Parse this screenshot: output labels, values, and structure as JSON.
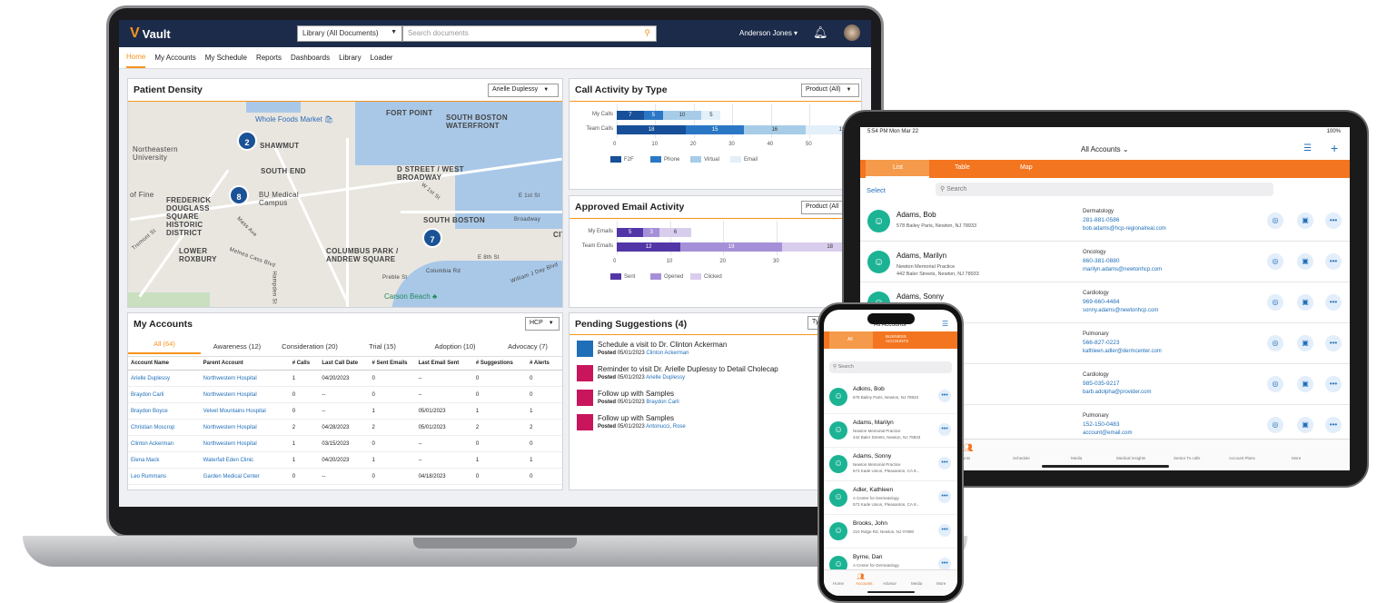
{
  "laptop": {
    "app_name": "Vault",
    "library_select": "Library (All Documents)",
    "search_placeholder": "Search documents",
    "user_name": "Anderson Jones",
    "nav": [
      "Home",
      "My Accounts",
      "My Schedule",
      "Reports",
      "Dashboards",
      "Library",
      "Loader"
    ],
    "patient_density": {
      "title": "Patient Density",
      "filter": "Arielle Duplessy",
      "map_labels": [
        "FORT POINT",
        "SOUTH BOSTON WATERFRONT",
        "SHAWMUT",
        "Northeastern University",
        "SOUTH END",
        "D STREET / WEST BROADWAY",
        "FREDERICK DOUGLASS SQUARE HISTORIC DISTRICT",
        "BU Medical Campus",
        "SOUTH BOSTON",
        "LOWER ROXBURY",
        "COLUMBUS PARK / ANDREW SQUARE",
        "CIT",
        "of Fine"
      ],
      "pois": [
        "Whole Foods Market",
        "Carson Beach"
      ],
      "clusters": [
        "2",
        "8",
        "7"
      ],
      "street_labels": [
        "E 1st St",
        "Broadway",
        "W 1st St",
        "E 8th St",
        "Preble St",
        "Columbia Rd",
        "William J Day Blvd",
        "Tremont St",
        "Mass Ave",
        "Melnea Cass Blvd",
        "Hampden St"
      ]
    },
    "call_activity": {
      "title": "Call Activity by Type",
      "filter": "Product (All)",
      "rows": [
        {
          "label": "My Calls",
          "values": [
            "7",
            "5",
            "10",
            "5"
          ]
        },
        {
          "label": "Team Calls",
          "values": [
            "18",
            "15",
            "16",
            "19"
          ]
        }
      ],
      "axis": [
        "0",
        "10",
        "20",
        "30",
        "40",
        "50"
      ],
      "legend": [
        "F2F",
        "Phone",
        "Virtual",
        "Email"
      ],
      "colors": [
        "#174f99",
        "#2a78c5",
        "#a7cce8",
        "#e3eff9"
      ]
    },
    "email_activity": {
      "title": "Approved Email Activity",
      "filter": "Product (All",
      "rows": [
        {
          "label": "My Emails",
          "values": [
            "5",
            "3",
            "6"
          ]
        },
        {
          "label": "Team Emails",
          "values": [
            "12",
            "19",
            "18"
          ]
        }
      ],
      "axis": [
        "0",
        "10",
        "20",
        "30"
      ],
      "legend": [
        "Sent",
        "Opened",
        "Clicked"
      ],
      "colors": [
        "#5236a8",
        "#a590d8",
        "#d9cdee"
      ]
    },
    "my_accounts": {
      "title": "My Accounts",
      "filter": "HCP",
      "tabs": [
        "All (64)",
        "Awareness (12)",
        "Consideration (20)",
        "Trial (15)",
        "Adoption (10)",
        "Advocacy (7)"
      ],
      "columns": [
        "Account Name",
        "Parent Account",
        "# Calls",
        "Last Call Date",
        "# Sent Emails",
        "Last Email Sent",
        "# Suggestions",
        "# Alerts"
      ],
      "rows": [
        [
          "Arielle Duplessy",
          "Northwestern Hospital",
          "1",
          "04/20/2023",
          "0",
          "--",
          "0",
          "0"
        ],
        [
          "Braydon Carli",
          "Northwestern Hospital",
          "0",
          "--",
          "0",
          "--",
          "0",
          "0"
        ],
        [
          "Braydon Boyce",
          "Velvet Mountains Hospital",
          "0",
          "--",
          "1",
          "05/01/2023",
          "1",
          "1"
        ],
        [
          "Christian Moscrop",
          "Northwestern Hospital",
          "2",
          "04/28/2023",
          "2",
          "05/01/2023",
          "2",
          "2"
        ],
        [
          "Clinton Ackerman",
          "Northwestern Hospital",
          "1",
          "03/15/2023",
          "0",
          "--",
          "0",
          "0"
        ],
        [
          "Elena Mack",
          "Waterfall Eden Clinic",
          "1",
          "04/20/2023",
          "1",
          "--",
          "1",
          "1"
        ],
        [
          "Leo Rummans",
          "Garden Medical Center",
          "0",
          "--",
          "0",
          "04/18/2023",
          "0",
          "0"
        ]
      ]
    },
    "suggestions": {
      "title": "Pending Suggestions (4)",
      "filter": "Ty",
      "items": [
        {
          "title": "Schedule a visit to Dr. Clinton Ackerman",
          "posted_label": "Posted",
          "date": "05/01/2023",
          "who": "Clinton Ackerman",
          "color": "#1f6fb8"
        },
        {
          "title": "Reminder to visit Dr. Arielle Duplessy to Detail Cholecap",
          "posted_label": "Posted",
          "date": "05/01/2023",
          "who": "Arielle Duplessy",
          "color": "#c8155c"
        },
        {
          "title": "Follow up with Samples",
          "posted_label": "Posted",
          "date": "05/01/2023",
          "who": "Braydon Carli",
          "color": "#c8155c"
        },
        {
          "title": "Follow up with Samples",
          "posted_label": "Posted",
          "date": "05/01/2023",
          "who": "Antonucci, Rose",
          "color": "#c8155c"
        }
      ]
    }
  },
  "tablet": {
    "status_time": "5:54 PM   Mon Mar 22",
    "status_right": "100%",
    "title": "All Accounts",
    "tabs": [
      "List",
      "Table",
      "Map"
    ],
    "select_label": "Select",
    "search_placeholder": "Search",
    "rows": [
      {
        "name": "Adams, Bob",
        "line1": "578 Bailey Paris, Newton, NJ 78933",
        "line2": "",
        "spec": "Dermatology",
        "phone": "281-881-0586",
        "email": "bob.adams@hcp-regionalreal.com"
      },
      {
        "name": "Adams, Marilyn",
        "line1": "Newton Memorial Practice",
        "line2": "442 Baler Streets, Newton, NJ 78933",
        "spec": "Oncology",
        "phone": "860-381-0880",
        "email": "marilyn.adams@newtonhcp.com"
      },
      {
        "name": "Adams, Sonny",
        "line1": "actice",
        "line2": "n, CA 94588",
        "spec": "Cardiology",
        "phone": "969-660-4484",
        "email": "sonny.adams@newtonhcp.com"
      },
      {
        "name": "",
        "line1": "y",
        "line2": "07890",
        "spec": "Pulmonary",
        "phone": "566-827-0223",
        "email": "kathleen.adler@dermcenter.com"
      },
      {
        "name": "",
        "line1": "",
        "line2": "07890",
        "spec": "Cardiology",
        "phone": "985-035-9217",
        "email": "barb.adolpha@provider.com"
      },
      {
        "name": "",
        "line1": "il",
        "line2": "",
        "spec": "Pulmonary",
        "phone": "152-150-0483",
        "email": "account@email.com"
      }
    ],
    "tabbar": [
      "counts",
      "Schedule",
      "Media",
      "Medical Insights",
      "Sentor To calls",
      "Account Plans",
      "More"
    ]
  },
  "phone": {
    "title": "All Accounts",
    "tabs": [
      "All",
      "Business Accounts"
    ],
    "search_placeholder": "Search",
    "rows": [
      {
        "name": "Adkins, Bob",
        "line1": "578 Bailey Paris, Newton, NJ 78933",
        "line2": ""
      },
      {
        "name": "Adams, Marilyn",
        "line1": "Newton Memorial Practice",
        "line2": "442 Baler Streets, Newton, NJ 78933"
      },
      {
        "name": "Adams, Sonny",
        "line1": "Newton Memorial Practice",
        "line2": "573 Kade Union, Pleasanton, CA 9..."
      },
      {
        "name": "Adler, Kathleen",
        "line1": "A Center for Dermatology",
        "line2": "573 Kade Union, Pleasanton, CA 9..."
      },
      {
        "name": "Brooks, John",
        "line1": "210 Ridge Rd, Newton, NJ 07890",
        "line2": ""
      },
      {
        "name": "Byrne, Dan",
        "line1": "A Center for Dermatology",
        "line2": ""
      }
    ],
    "tabbar": [
      "Home",
      "Accounts",
      "Advisor",
      "Media",
      "More"
    ]
  }
}
